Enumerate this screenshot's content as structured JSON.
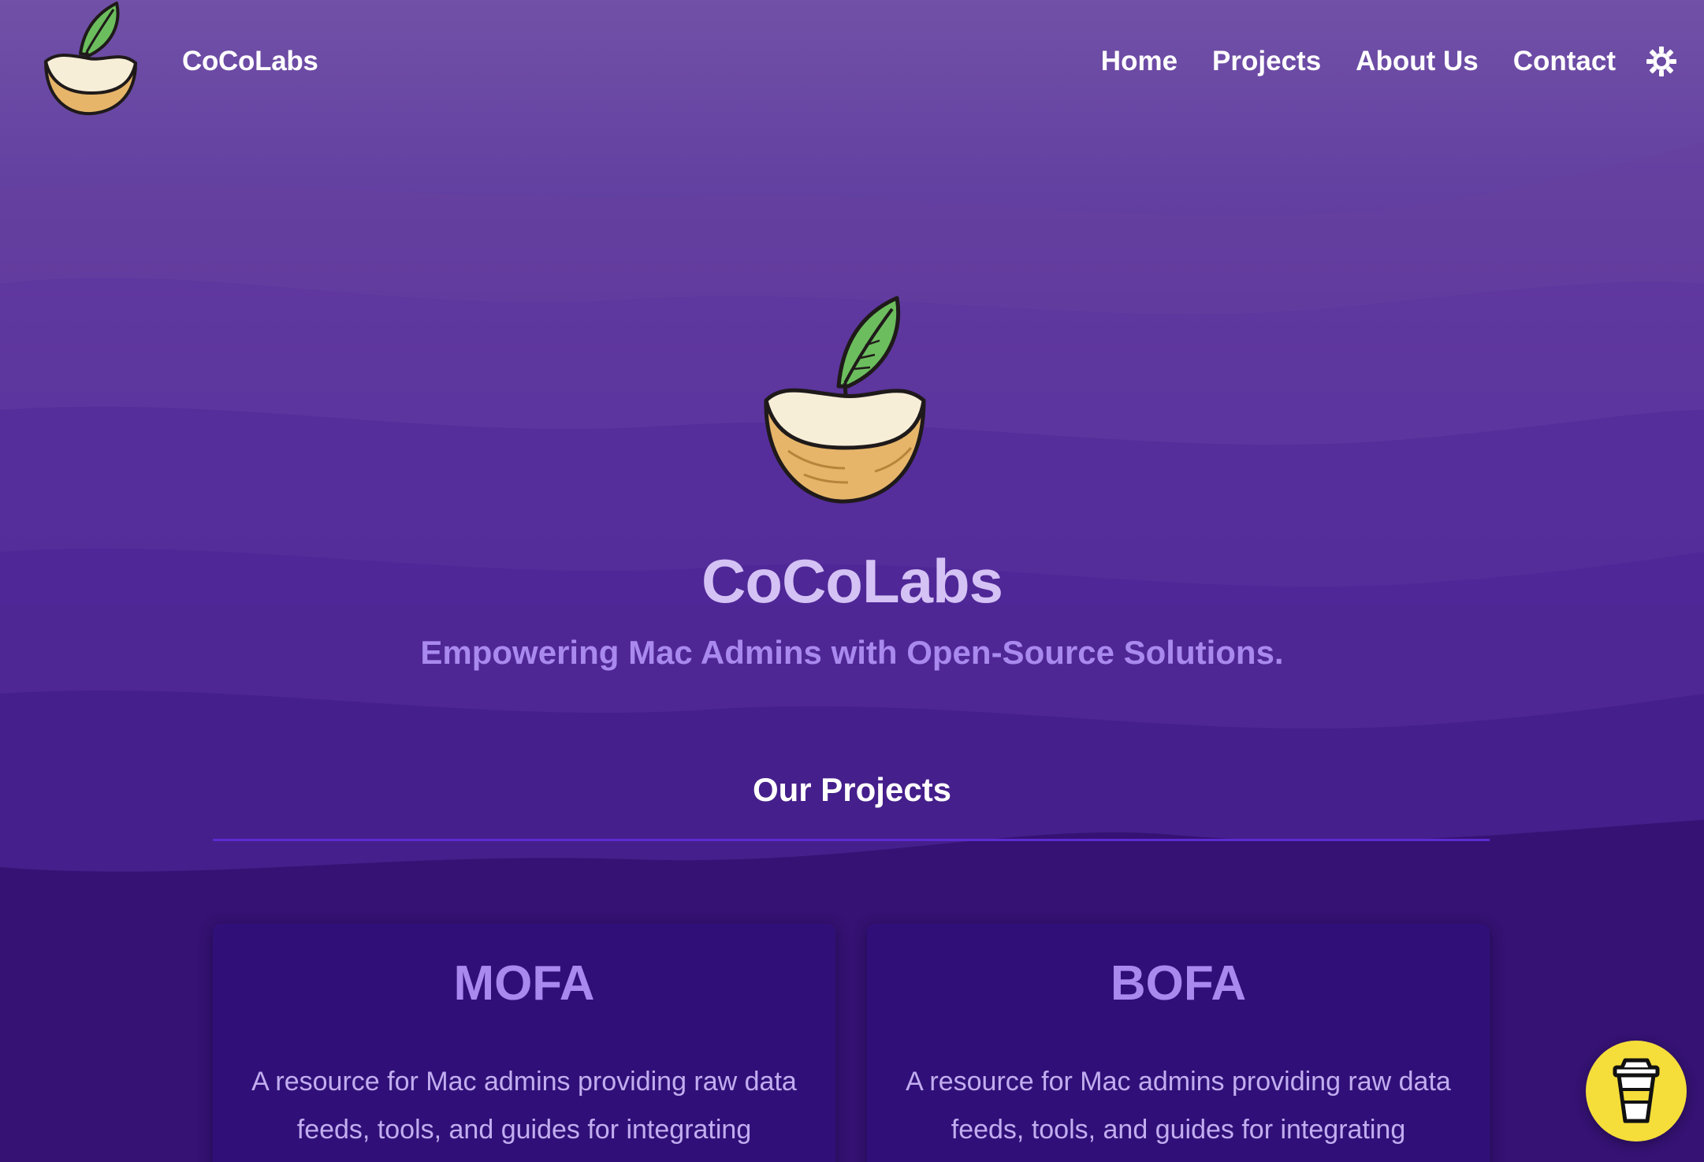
{
  "header": {
    "brand_name": "CoCoLabs",
    "logo_icon": "coconut-sprout-icon",
    "nav": [
      {
        "label": "Home"
      },
      {
        "label": "Projects"
      },
      {
        "label": "About Us"
      },
      {
        "label": "Contact"
      }
    ],
    "theme_toggle_icon": "sun-icon"
  },
  "hero": {
    "logo_icon": "coconut-sprout-icon",
    "title": "CoCoLabs",
    "tagline": "Empowering Mac Admins with Open-Source Solutions."
  },
  "projects": {
    "heading": "Our Projects",
    "cards": [
      {
        "title": "MOFA",
        "description": "A resource for Mac admins providing raw data feeds, tools, and guides for integrating"
      },
      {
        "title": "BOFA",
        "description": "A resource for Mac admins providing raw data feeds, tools, and guides for integrating"
      }
    ]
  },
  "floating_button": {
    "icon": "coffee-cup-icon"
  },
  "colors": {
    "background_top": "#7151a7",
    "background_bottom": "#2e0f6d",
    "title": "#d4c2f5",
    "accent": "#a989ee",
    "card_bg": "#301078",
    "divider": "#5d2ad1",
    "coffee_button": "#f5dd3a"
  }
}
